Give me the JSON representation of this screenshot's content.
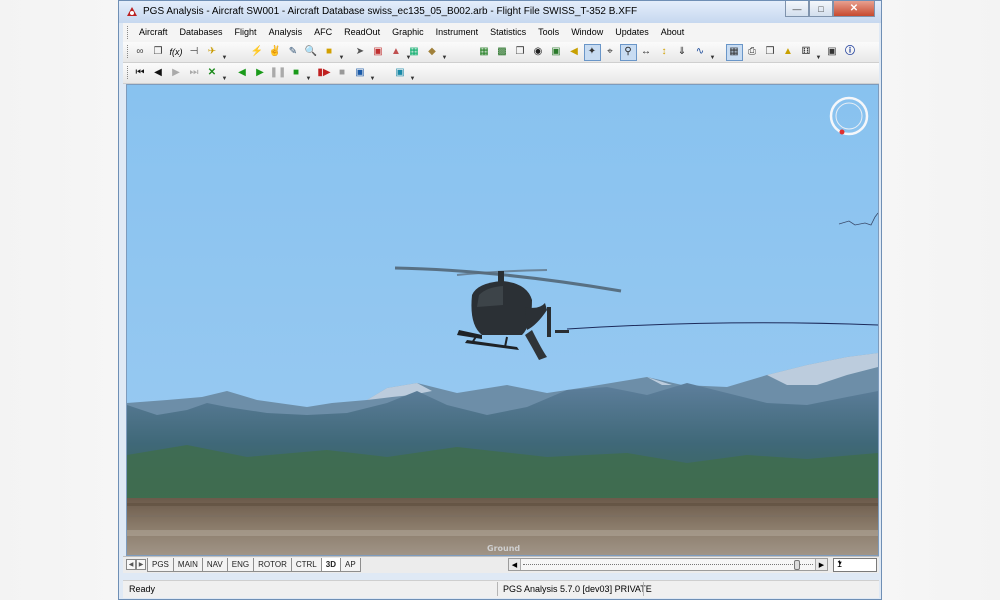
{
  "window": {
    "title": "PGS Analysis - Aircraft SW001 - Aircraft Database swiss_ec135_05_B002.arb - Flight File SWISS_T-352 B.XFF",
    "controls": [
      "minimize-icon",
      "maximize-icon",
      "close-icon"
    ]
  },
  "menu": [
    "Aircraft",
    "Databases",
    "Flight",
    "Analysis",
    "AFC",
    "ReadOut",
    "Graphic",
    "Instrument",
    "Statistics",
    "Tools",
    "Window",
    "Updates",
    "About"
  ],
  "toolbar1": {
    "groups": [
      [
        "link-icon",
        "copy-icon",
        "fx-icon",
        "bracket-icon",
        "aircraft-icon"
      ],
      [
        "lightning-icon",
        "hand-icon",
        "edit-icon",
        "zoom-doc-icon",
        "highlight-icon"
      ],
      [
        "pointer-icon",
        "folder-icon",
        "open-icon"
      ],
      [
        "grid-table-icon",
        "tag-icon"
      ],
      [
        "spreadsheet-icon",
        "chart-icon",
        "copy-window-icon",
        "binoculars-icon",
        "image-icon",
        "play-sound-icon",
        "cursor-cross-icon",
        "crosshair-icon",
        "magnifier-icon",
        "width-icon",
        "height-icon",
        "arrow-down-icon",
        "graph-line-icon"
      ],
      [
        "grid-icon",
        "print-icon",
        "print-preview-icon",
        "paint-icon",
        "dice-icon"
      ],
      [
        "camera-icon",
        "info-icon"
      ]
    ]
  },
  "toolbar2": {
    "groups": [
      [
        "skip-first-icon",
        "step-back-icon",
        "step-forward-icon",
        "skip-last-icon",
        "clear-icon"
      ],
      [
        "play-reverse-icon",
        "play-icon",
        "pause-icon",
        "stop-icon"
      ],
      [
        "record-icon",
        "stop-gray-icon",
        "export-icon"
      ],
      [
        "display-icon"
      ]
    ]
  },
  "viewport": {
    "ground_label": "Ground",
    "sky_color": "#8ec5ef",
    "flight_path_color": "#1c2a5a"
  },
  "tabs": {
    "items": [
      "PGS",
      "MAIN",
      "NAV",
      "ENG",
      "ROTOR",
      "CTRL",
      "3D",
      "AP"
    ],
    "active": "3D"
  },
  "playback": {
    "position_fraction": 0.98,
    "speed": "1"
  },
  "status": {
    "left": "Ready",
    "middle": "PGS Analysis 5.7.0 [dev03] PRIVATE"
  }
}
